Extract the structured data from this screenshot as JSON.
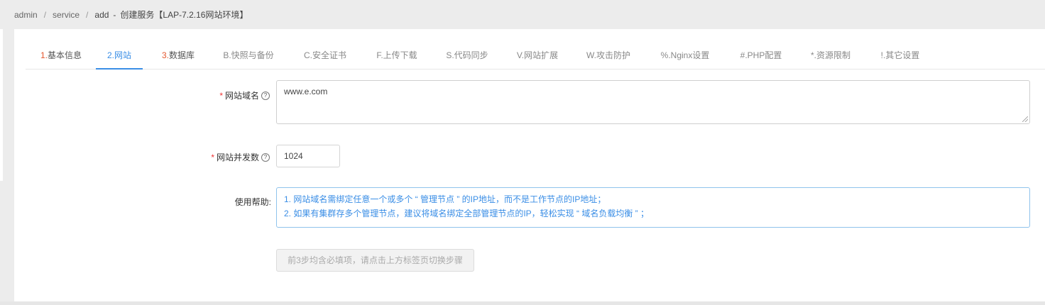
{
  "breadcrumb": {
    "items": [
      "admin",
      "service",
      "add"
    ],
    "separator": "/",
    "dash": "-",
    "page_title": "创建服务【LAP-7.2.16网站环境】"
  },
  "tabs": [
    {
      "num": "1.",
      "label": "基本信息",
      "state": "done"
    },
    {
      "num": "2.",
      "label": "网站",
      "state": "active"
    },
    {
      "num": "3.",
      "label": "数据库",
      "state": "done"
    },
    {
      "num": "",
      "label": "B.快照与备份",
      "state": "normal"
    },
    {
      "num": "",
      "label": "C.安全证书",
      "state": "normal"
    },
    {
      "num": "",
      "label": "F.上传下载",
      "state": "normal"
    },
    {
      "num": "",
      "label": "S.代码同步",
      "state": "normal"
    },
    {
      "num": "",
      "label": "V.网站扩展",
      "state": "normal"
    },
    {
      "num": "",
      "label": "W.攻击防护",
      "state": "normal"
    },
    {
      "num": "",
      "label": "%.Nginx设置",
      "state": "normal"
    },
    {
      "num": "",
      "label": "#.PHP配置",
      "state": "normal"
    },
    {
      "num": "",
      "label": "*.资源限制",
      "state": "normal"
    },
    {
      "num": "",
      "label": "!.其它设置",
      "state": "normal"
    }
  ],
  "form": {
    "domain": {
      "required_mark": "*",
      "label": "网站域名",
      "value": "www.e.com"
    },
    "concurrency": {
      "required_mark": "*",
      "label": "网站并发数",
      "value": "1024"
    },
    "help": {
      "label": "使用帮助:",
      "lines": [
        "1. 网站域名需绑定任意一个或多个 “ 管理节点 ” 的IP地址，而不是工作节点的IP地址；",
        "2. 如果有集群存多个管理节点，建议将域名绑定全部管理节点的IP，轻松实现 “ 域名负载均衡 ” ；"
      ]
    },
    "submit_label": "前3步均含必填项，请点击上方标签页切换步骤"
  },
  "colors": {
    "accent": "#3a8ee6",
    "required": "#e33333",
    "step_number": "#e4572e"
  },
  "icons": {
    "help": "question-circle-icon"
  }
}
